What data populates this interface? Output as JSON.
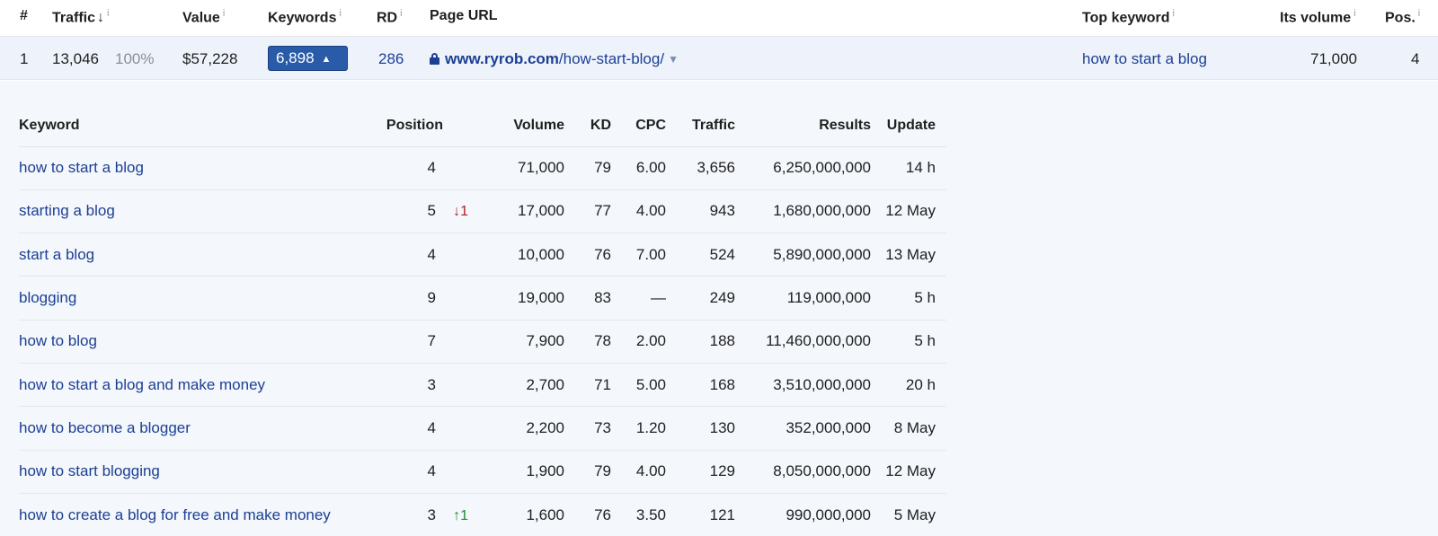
{
  "header": {
    "col_num": "#",
    "col_traffic": "Traffic",
    "traffic_sort_arrow": "↓",
    "col_value": "Value",
    "col_keywords": "Keywords",
    "col_rd": "RD",
    "col_page_url": "Page URL",
    "col_top_keyword": "Top keyword",
    "col_its_volume": "Its volume",
    "col_pos": "Pos.",
    "info_marker": "i"
  },
  "summary": {
    "index": "1",
    "traffic": "13,046",
    "traffic_share": "100%",
    "value": "$57,228",
    "keywords": "6,898",
    "keywords_toggle": "▲",
    "rd": "286",
    "url_domain": "www.ryrob.com",
    "url_path": "/how-start-blog/",
    "top_keyword": "how to start a blog",
    "its_volume": "71,000",
    "pos": "4"
  },
  "keyword_table": {
    "columns": {
      "keyword": "Keyword",
      "position": "Position",
      "volume": "Volume",
      "kd": "KD",
      "cpc": "CPC",
      "traffic": "Traffic",
      "results": "Results",
      "update": "Update"
    },
    "rows": [
      {
        "keyword": "how to start a blog",
        "position": "4",
        "change": "",
        "change_dir": "",
        "volume": "71,000",
        "kd": "79",
        "cpc": "6.00",
        "traffic": "3,656",
        "results": "6,250,000,000",
        "update": "14 h"
      },
      {
        "keyword": "starting a blog",
        "position": "5",
        "change": "↓1",
        "change_dir": "down",
        "volume": "17,000",
        "kd": "77",
        "cpc": "4.00",
        "traffic": "943",
        "results": "1,680,000,000",
        "update": "12 May"
      },
      {
        "keyword": "start a blog",
        "position": "4",
        "change": "",
        "change_dir": "",
        "volume": "10,000",
        "kd": "76",
        "cpc": "7.00",
        "traffic": "524",
        "results": "5,890,000,000",
        "update": "13 May"
      },
      {
        "keyword": "blogging",
        "position": "9",
        "change": "",
        "change_dir": "",
        "volume": "19,000",
        "kd": "83",
        "cpc": "—",
        "traffic": "249",
        "results": "119,000,000",
        "update": "5 h"
      },
      {
        "keyword": "how to blog",
        "position": "7",
        "change": "",
        "change_dir": "",
        "volume": "7,900",
        "kd": "78",
        "cpc": "2.00",
        "traffic": "188",
        "results": "11,460,000,000",
        "update": "5 h"
      },
      {
        "keyword": "how to start a blog and make money",
        "position": "3",
        "change": "",
        "change_dir": "",
        "volume": "2,700",
        "kd": "71",
        "cpc": "5.00",
        "traffic": "168",
        "results": "3,510,000,000",
        "update": "20 h"
      },
      {
        "keyword": "how to become a blogger",
        "position": "4",
        "change": "",
        "change_dir": "",
        "volume": "2,200",
        "kd": "73",
        "cpc": "1.20",
        "traffic": "130",
        "results": "352,000,000",
        "update": "8 May"
      },
      {
        "keyword": "how to start blogging",
        "position": "4",
        "change": "",
        "change_dir": "",
        "volume": "1,900",
        "kd": "79",
        "cpc": "4.00",
        "traffic": "129",
        "results": "8,050,000,000",
        "update": "12 May"
      },
      {
        "keyword": "how to create a blog for free and make money",
        "position": "3",
        "change": "↑1",
        "change_dir": "up",
        "volume": "1,600",
        "kd": "76",
        "cpc": "3.50",
        "traffic": "121",
        "results": "990,000,000",
        "update": "5 May"
      }
    ]
  }
}
